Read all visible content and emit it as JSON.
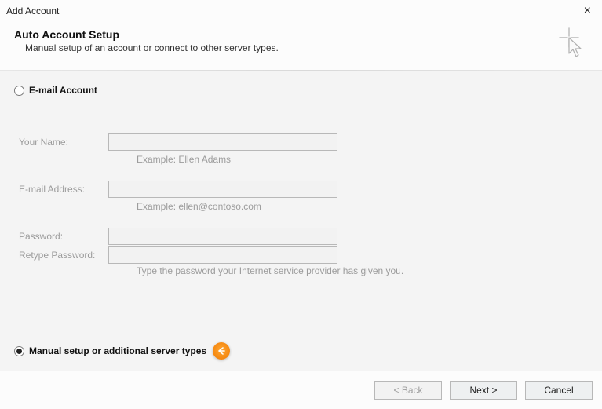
{
  "window": {
    "title": "Add Account"
  },
  "header": {
    "title": "Auto Account Setup",
    "subtitle": "Manual setup of an account or connect to other server types."
  },
  "options": {
    "email": {
      "label": "E-mail Account",
      "selected": false
    },
    "manual": {
      "label": "Manual setup or additional server types",
      "selected": true
    }
  },
  "form": {
    "yourName": {
      "label": "Your Name:",
      "value": "",
      "hint": "Example: Ellen Adams"
    },
    "email": {
      "label": "E-mail Address:",
      "value": "",
      "hint": "Example: ellen@contoso.com"
    },
    "password": {
      "label": "Password:",
      "value": ""
    },
    "retype": {
      "label": "Retype Password:",
      "value": "",
      "hint": "Type the password your Internet service provider has given you."
    }
  },
  "footer": {
    "back": "< Back",
    "next": "Next >",
    "cancel": "Cancel"
  }
}
